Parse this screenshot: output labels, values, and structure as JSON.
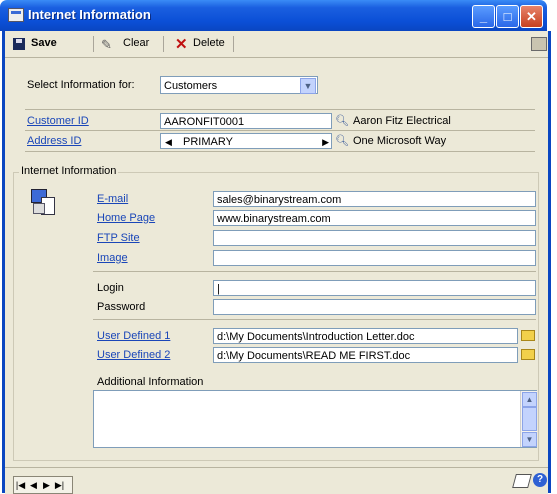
{
  "window": {
    "title": "Internet Information"
  },
  "toolbar": {
    "save": "Save",
    "clear": "Clear",
    "delete": "Delete"
  },
  "select_info": {
    "label": "Select Information for:",
    "value": "Customers"
  },
  "customer": {
    "label": "Customer ID",
    "id": "AARONFIT0001",
    "name": "Aaron Fitz Electrical"
  },
  "address": {
    "label": "Address ID",
    "id": "PRIMARY",
    "name": "One Microsoft Way"
  },
  "group_title": "Internet Information",
  "fields": {
    "email": {
      "label": "E-mail",
      "value": "sales@binarystream.com"
    },
    "homepage": {
      "label": "Home Page",
      "value": "www.binarystream.com"
    },
    "ftp": {
      "label": "FTP Site",
      "value": ""
    },
    "image": {
      "label": "Image",
      "value": ""
    },
    "login": {
      "label": "Login",
      "value": "|"
    },
    "password": {
      "label": "Password",
      "value": ""
    },
    "user1": {
      "label": "User Defined 1",
      "value": "d:\\My Documents\\Introduction Letter.doc"
    },
    "user2": {
      "label": "User Defined 2",
      "value": "d:\\My Documents\\READ ME FIRST.doc"
    }
  },
  "additional": {
    "label": "Additional Information",
    "value": ""
  },
  "colors": {
    "title_bar": "#0b4fd6",
    "link": "#1a46b8",
    "background": "#ece9d8"
  },
  "icons": [
    "save-icon",
    "clear-icon",
    "delete-icon",
    "print-icon",
    "lookup-icon",
    "folder-icon",
    "note-icon",
    "help-icon"
  ]
}
